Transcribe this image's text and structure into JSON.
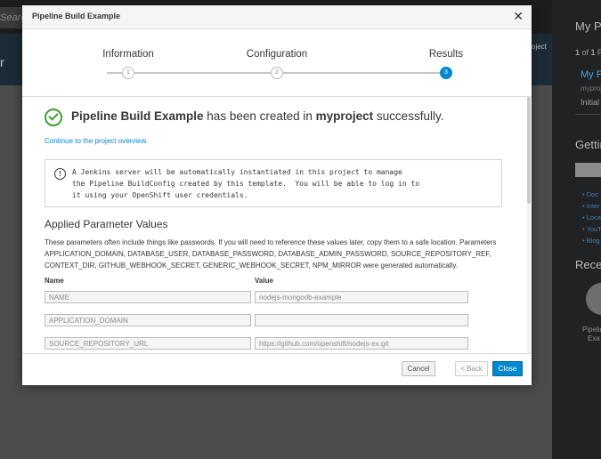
{
  "background": {
    "search_placeholder": "Search C",
    "band_left_text": "r",
    "band_right_text": "oject",
    "right_panel": {
      "title": "My Pr",
      "count_prefix": "1",
      "count_mid": " of ",
      "count_total": "1",
      "count_suffix": " Pr",
      "project_name": "My P",
      "project_sub": "myproj",
      "project_status": "Initial e",
      "getting_started": "Gettin",
      "links": [
        "Doc",
        "Inter",
        "Loca",
        "YouT",
        "Blog"
      ],
      "recent": "Recen",
      "recent_item_line1": "Pipelin",
      "recent_item_line2": "Exa"
    }
  },
  "modal": {
    "title": "Pipeline Build Example",
    "close_icon": "close-icon",
    "steps": [
      {
        "label": "Information",
        "number": "1",
        "active": false
      },
      {
        "label": "Configuration",
        "number": "2",
        "active": false
      },
      {
        "label": "Results",
        "number": "3",
        "active": true
      }
    ],
    "result": {
      "template_name": "Pipeline Build Example",
      "middle_text": " has been created in ",
      "project": "myproject",
      "suffix": " successfully.",
      "continue_link": "Continue to the project overview."
    },
    "info": {
      "icon": "info-icon",
      "text": "A Jenkins server will be automatically instantiated in this project to manage\nthe Pipeline BuildConfig created by this template.  You will be able to log in to\nit using your OpenShift user credentials."
    },
    "params": {
      "title": "Applied Parameter Values",
      "description": "These parameters often include things like passwords. If you will need to reference these values later, copy them to a safe location. Parameters APPLICATION_DOMAIN, DATABASE_USER, DATABASE_PASSWORD, DATABASE_ADMIN_PASSWORD, SOURCE_REPOSITORY_REF, CONTEXT_DIR, GITHUB_WEBHOOK_SECRET, GENERIC_WEBHOOK_SECRET, NPM_MIRROR were generated automatically.",
      "name_header": "Name",
      "value_header": "Value",
      "rows": [
        {
          "name": "NAME",
          "value": "nodejs-mongodb-example"
        },
        {
          "name": "APPLICATION_DOMAIN",
          "value": ""
        },
        {
          "name": "SOURCE_REPOSITORY_URL",
          "value": "https://github.com/openshift/nodejs-ex.git"
        }
      ]
    },
    "footer": {
      "cancel": "Cancel",
      "back": "< Back",
      "close": "Close"
    }
  }
}
